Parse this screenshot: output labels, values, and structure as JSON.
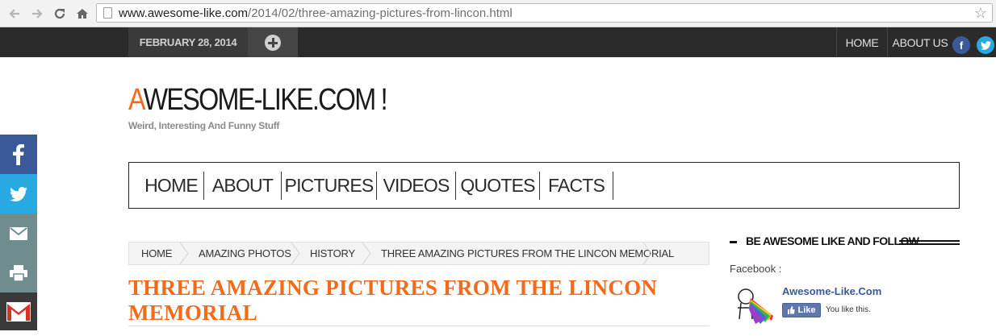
{
  "browser": {
    "url_domain": "www.awesome-like.com",
    "url_path": "/2014/02/three-amazing-pictures-from-lincon.html"
  },
  "topbar": {
    "date": "FEBRUARY 28, 2014",
    "links": [
      "HOME",
      "ABOUT US"
    ],
    "social": [
      {
        "icon": "facebook-icon",
        "glyph": "f",
        "color": "#3b5998"
      },
      {
        "icon": "twitter-icon",
        "glyph": "t",
        "color": "#29a9e1"
      }
    ]
  },
  "logo": {
    "accent_letter": "A",
    "rest": "WESOME-LIKE.COM !",
    "accent_color": "#f26a1b",
    "tagline": "Weird, Interesting And Funny Stuff"
  },
  "main_nav": [
    "HOME",
    "ABOUT",
    "PICTURES",
    "VIDEOS",
    "QUOTES",
    "FACTS"
  ],
  "breadcrumb": [
    "HOME",
    "AMAZING PHOTOS",
    "HISTORY",
    "THREE AMAZING PICTURES FROM THE LINCON MEMORIAL"
  ],
  "post": {
    "title": "THREE AMAZING PICTURES FROM THE LINCON MEMORIAL"
  },
  "sidebar": {
    "widget_title": "BE AWESOME LIKE AND FOLLOW",
    "facebook_label": "Facebook :",
    "fb_page_name": "Awesome-Like.Com",
    "fb_like_button": "Like",
    "fb_like_status": "You like this."
  },
  "share_bar": [
    {
      "icon": "facebook-icon",
      "color": "#3b5998"
    },
    {
      "icon": "twitter-icon",
      "color": "#29a9e1"
    },
    {
      "icon": "email-icon",
      "color": "#6f8c8f"
    },
    {
      "icon": "print-icon",
      "color": "#6f8c8f"
    },
    {
      "icon": "gmail-icon",
      "color": "#3a3a3a"
    }
  ]
}
